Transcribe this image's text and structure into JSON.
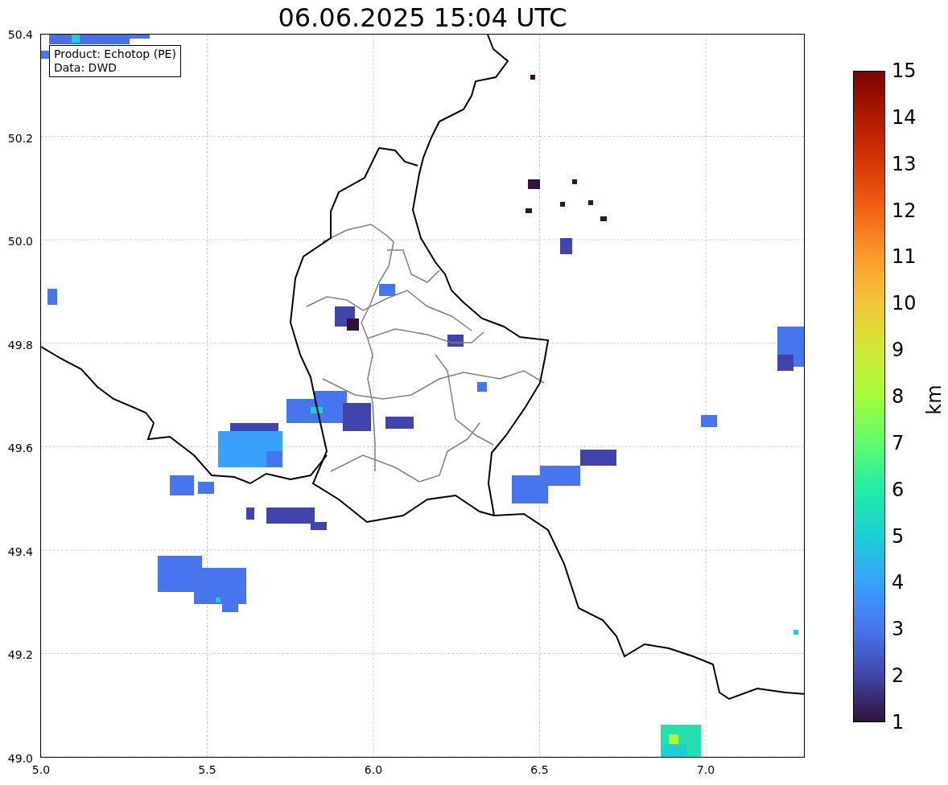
{
  "title": "06.06.2025 15:04 UTC",
  "legend": {
    "lines": [
      "Product: Echotop (PE)",
      "Data: DWD"
    ]
  },
  "map": {
    "x_ticks": [
      "5.0",
      "5.5",
      "6.0",
      "6.5",
      "7.0"
    ],
    "y_ticks": [
      "50.4",
      "50.2",
      "50.0",
      "49.8",
      "49.6",
      "49.4",
      "49.2",
      "49.0"
    ]
  },
  "colorbar": {
    "label": "km",
    "ticks": [
      "15",
      "14",
      "13",
      "12",
      "11",
      "10",
      "9",
      "8",
      "7",
      "6",
      "5",
      "4",
      "3",
      "2",
      "1"
    ]
  }
}
